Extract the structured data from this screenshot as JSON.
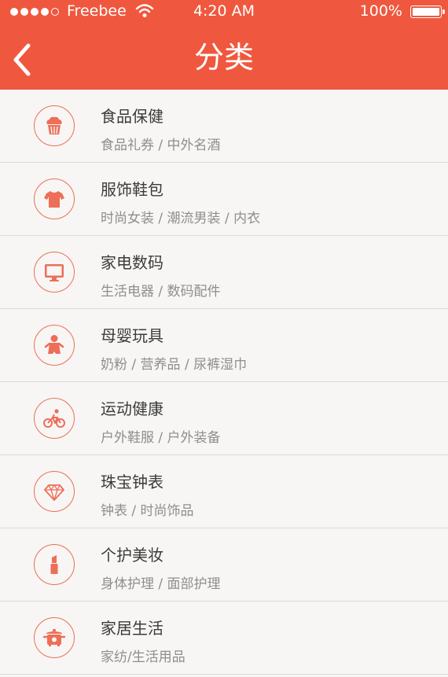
{
  "status_bar": {
    "carrier": "Freebee",
    "time": "4:20 AM",
    "battery": "100%"
  },
  "header": {
    "title": "分类",
    "back_icon": "chevron-left-icon"
  },
  "colors": {
    "accent": "#ef583e",
    "background": "#f7f6f4",
    "divider": "#dddbd8"
  },
  "categories": [
    {
      "name": "食品保健",
      "sub": "食品礼券 / 中外名酒",
      "icon": "cupcake-icon"
    },
    {
      "name": "服饰鞋包",
      "sub": "时尚女装 / 潮流男装 / 内衣",
      "icon": "shirt-icon"
    },
    {
      "name": "家电数码",
      "sub": "生活电器 / 数码配件",
      "icon": "monitor-icon"
    },
    {
      "name": "母婴玩具",
      "sub": "奶粉 / 营养品 / 尿裤湿巾",
      "icon": "baby-icon"
    },
    {
      "name": "运动健康",
      "sub": "户外鞋服 / 户外装备",
      "icon": "cyclist-icon"
    },
    {
      "name": "珠宝钟表",
      "sub": "钟表 / 时尚饰品",
      "icon": "diamond-icon"
    },
    {
      "name": "个护美妆",
      "sub": "身体护理 / 面部护理",
      "icon": "lipstick-icon"
    },
    {
      "name": "家居生活",
      "sub": "家纺/生活用品",
      "icon": "pot-icon"
    }
  ]
}
